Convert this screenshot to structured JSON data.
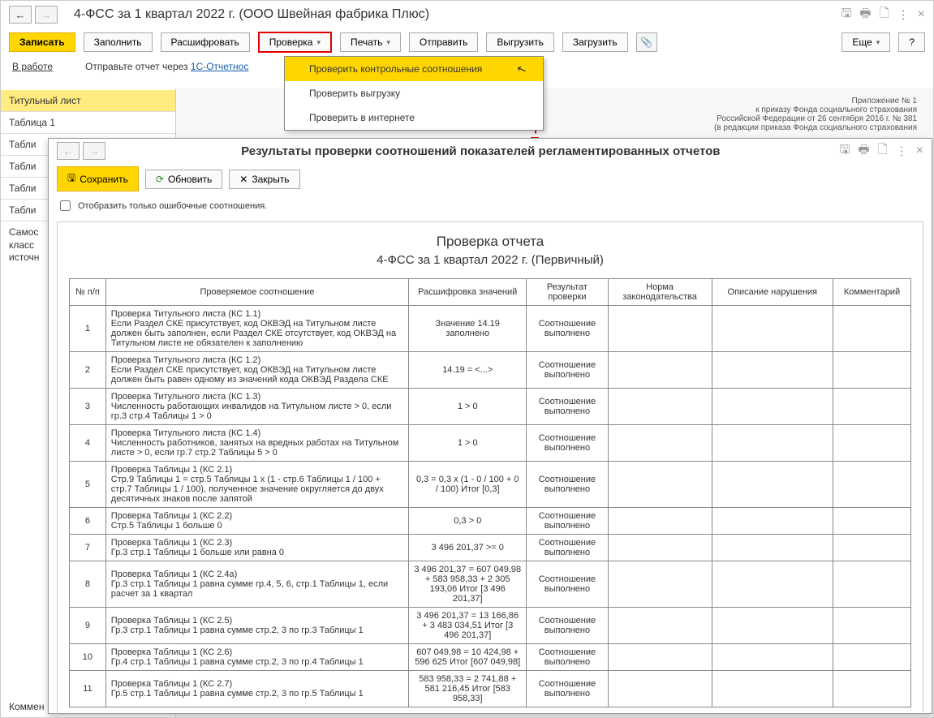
{
  "window1": {
    "title": "4-ФСС за 1 квартал 2022 г. (ООО Швейная фабрика Плюс)",
    "toolbar": {
      "record": "Записать",
      "fill": "Заполнить",
      "decrypt": "Расшифровать",
      "check": "Проверка",
      "print": "Печать",
      "send": "Отправить",
      "export": "Выгрузить",
      "import": "Загрузить",
      "more": "Еще",
      "help": "?"
    },
    "status": {
      "label": "В работе",
      "hint_pre": "Отправьте отчет через ",
      "hint_link": "1С-Отчетнос"
    },
    "dropdown": {
      "item1": "Проверить контрольные соотношения",
      "item2": "Проверить выгрузку",
      "item3": "Проверить в интернете"
    },
    "sidebar": {
      "tab_title": "Титульный лист",
      "tab_t1": "Таблица 1",
      "tab_t2": "Табли",
      "tab_t3": "Табли",
      "tab_t4": "Табли",
      "tab_t5": "Табли",
      "tab_self1": "Самос",
      "tab_self2": "класс",
      "tab_self3": "источн"
    },
    "doc": {
      "l1": "Приложение № 1",
      "l2": "к приказу Фонда социального страхования",
      "l3": "Российской Федерации от 26 сентября 2016 г. № 381",
      "l4": "(в редакции приказа Фонда социального страхования"
    },
    "comment": "Коммен"
  },
  "window2": {
    "title": "Результаты проверки соотношений показателей регламентированных отчетов",
    "toolbar": {
      "save": "Сохранить",
      "refresh": "Обновить",
      "close": "Закрыть"
    },
    "checkbox_label": "Отобразить только ошибочные соотношения.",
    "report_title": "Проверка отчета",
    "report_subtitle": "4-ФСС за 1 квартал 2022 г. (Первичный)",
    "headers": {
      "n": "№ п/п",
      "rel": "Проверяемое соотношение",
      "dec": "Расшифровка значений",
      "res": "Результат проверки",
      "norm": "Норма законодательства",
      "desc": "Описание нарушения",
      "comm": "Комментарий"
    },
    "rows": [
      {
        "n": "1",
        "rel": "Проверка Титульного листа (КС 1.1)\nЕсли Раздел СКЕ присутствует, код ОКВЭД на Титульном листе должен быть заполнен, если Раздел СКЕ отсутствует, код ОКВЭД на Титульном листе не обязателен к заполнению",
        "dec": "Значение 14.19 заполнено",
        "res": "Соотношение выполнено"
      },
      {
        "n": "2",
        "rel": "Проверка Титульного листа (КС 1.2)\nЕсли Раздел СКЕ присутствует, код ОКВЭД на Титульном листе должен быть равен одному из значений кода ОКВЭД Раздела СКЕ",
        "dec": "14.19 = <...>",
        "res": "Соотношение выполнено"
      },
      {
        "n": "3",
        "rel": "Проверка Титульного листа (КС 1.3)\nЧисленность работающих инвалидов на Титульном листе > 0, если гр.3 стр.4 Таблицы 1 > 0",
        "dec": "1 > 0",
        "res": "Соотношение выполнено"
      },
      {
        "n": "4",
        "rel": "Проверка Титульного листа (КС 1.4)\nЧисленность работников, занятых на вредных работах на Титульном листе > 0, если гр.7 стр.2 Таблицы 5 > 0",
        "dec": "1 > 0",
        "res": "Соотношение выполнено"
      },
      {
        "n": "5",
        "rel": "Проверка Таблицы 1 (КС 2.1)\nСтр.9 Таблицы 1 = стр.5 Таблицы 1 x (1 - стр.6 Таблицы 1 / 100 + стр.7 Таблицы 1 / 100), полученное значение округляется до двух десятичных знаков после запятой",
        "dec": "0,3 = 0,3 x (1 - 0 / 100 + 0 / 100) Итог [0,3]",
        "res": "Соотношение выполнено"
      },
      {
        "n": "6",
        "rel": "Проверка Таблицы 1 (КС 2.2)\nСтр.5 Таблицы 1 больше 0",
        "dec": "0,3 > 0",
        "res": "Соотношение выполнено"
      },
      {
        "n": "7",
        "rel": "Проверка Таблицы 1 (КС 2.3)\nГр.3 стр.1 Таблицы 1 больше или равна 0",
        "dec": "3 496 201,37 >= 0",
        "res": "Соотношение выполнено"
      },
      {
        "n": "8",
        "rel": "Проверка Таблицы 1 (КС 2.4а)\nГр.3 стр.1 Таблицы 1 равна сумме гр.4, 5, 6, стр.1 Таблицы 1, если расчет за 1 квартал",
        "dec": "3 496 201,37 = 607 049,98 + 583 958,33 + 2 305 193,06 Итог [3 496 201,37]",
        "res": "Соотношение выполнено"
      },
      {
        "n": "9",
        "rel": "Проверка Таблицы 1 (КС 2.5)\nГр.3 стр.1 Таблицы 1 равна сумме стр.2, 3 по гр.3 Таблицы 1",
        "dec": "3 496 201,37 = 13 166,86 + 3 483 034,51 Итог [3 496 201,37]",
        "res": "Соотношение выполнено"
      },
      {
        "n": "10",
        "rel": "Проверка Таблицы 1 (КС 2.6)\nГр.4 стр.1 Таблицы 1 равна сумме стр.2, 3 по гр.4 Таблицы 1",
        "dec": "607 049,98 = 10 424,98 + 596 625 Итог [607 049,98]",
        "res": "Соотношение выполнено"
      },
      {
        "n": "11",
        "rel": "Проверка Таблицы 1 (КС 2.7)\nГр.5 стр.1 Таблицы 1 равна сумме стр.2, 3 по гр.5 Таблицы 1",
        "dec": "583 958,33 = 2 741,88 + 581 216,45 Итог [583 958,33]",
        "res": "Соотношение выполнено"
      }
    ]
  }
}
